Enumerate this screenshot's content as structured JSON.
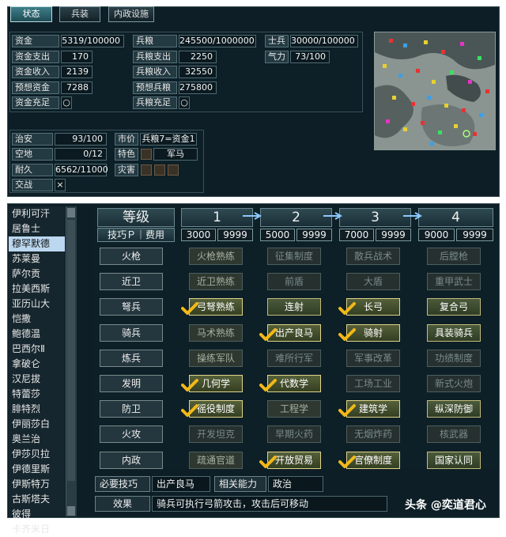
{
  "tabs": [
    "状态",
    "兵装",
    "内政设施"
  ],
  "stats": {
    "funds": {
      "label": "资金",
      "value": "5319/100000"
    },
    "funds_out": {
      "label": "资金支出",
      "value": "170"
    },
    "funds_in": {
      "label": "资金收入",
      "value": "2139"
    },
    "funds_est": {
      "label": "预想资金",
      "value": "7288"
    },
    "funds_ok": {
      "label": "资金充足",
      "value": "○"
    },
    "food": {
      "label": "兵粮",
      "value": "245500/1000000"
    },
    "food_out": {
      "label": "兵粮支出",
      "value": "2250"
    },
    "food_in": {
      "label": "兵粮收入",
      "value": "32550"
    },
    "food_est": {
      "label": "预想兵粮",
      "value": "275800"
    },
    "food_ok": {
      "label": "兵粮充足",
      "value": "○"
    },
    "soldiers": {
      "label": "士兵",
      "value": "30000/100000"
    },
    "morale": {
      "label": "气力",
      "value": "73/100"
    },
    "order": {
      "label": "治安",
      "value": "93/100"
    },
    "land": {
      "label": "空地",
      "value": "0/12"
    },
    "durability": {
      "label": "耐久",
      "value": "6562/11000"
    },
    "battle": {
      "label": "交战",
      "value": "×"
    },
    "price": {
      "label": "市价",
      "value": "兵粮7=资金1"
    },
    "feature": {
      "label": "特色",
      "value": "军马"
    },
    "disaster": {
      "label": "灾害"
    }
  },
  "rulers": [
    "伊利可汗",
    "居鲁士",
    "穆罕默德",
    "苏莱曼",
    "萨尔贡",
    "拉美西斯",
    "亚历山大",
    "恺撒",
    "鲍德温",
    "巴西尔Ⅱ",
    "拿破仑",
    "汉尼拔",
    "特蕾莎",
    "腓特烈",
    "伊丽莎白",
    "奥兰治",
    "伊莎贝拉",
    "伊德里斯",
    "伊斯特万",
    "古斯塔夫",
    "彼得",
    "卡齐米日"
  ],
  "selected_ruler": 2,
  "header": {
    "level_label": "等级",
    "tech_label": "技巧Ｐ｜费用",
    "levels": [
      "1",
      "2",
      "3",
      "4"
    ],
    "points": [
      "3000",
      "5000",
      "7000",
      "9000"
    ],
    "costs": [
      "9999",
      "9999",
      "9999",
      "9999"
    ]
  },
  "rows": [
    {
      "unit": "火枪",
      "skills": [
        "火枪熟练",
        "征集制度",
        "散兵战术",
        "后膛枪"
      ]
    },
    {
      "unit": "近卫",
      "skills": [
        "近卫熟练",
        "前盾",
        "大盾",
        "重甲武士"
      ]
    },
    {
      "unit": "弩兵",
      "skills": [
        "弓弩熟练",
        "连射",
        "长弓",
        "复合弓"
      ]
    },
    {
      "unit": "骑兵",
      "skills": [
        "马术熟练",
        "出产良马",
        "骑射",
        "具装骑兵"
      ]
    },
    {
      "unit": "炼兵",
      "skills": [
        "操练军队",
        "难所行军",
        "军事改革",
        "功绩制度"
      ]
    },
    {
      "unit": "发明",
      "skills": [
        "几何学",
        "代数学",
        "工场工业",
        "新式火炮"
      ]
    },
    {
      "unit": "防卫",
      "skills": [
        "徭役制度",
        "工程学",
        "建筑学",
        "纵深防御"
      ]
    },
    {
      "unit": "火攻",
      "skills": [
        "开发坦克",
        "早期火药",
        "无烟炸药",
        "核武器"
      ]
    },
    {
      "unit": "内政",
      "skills": [
        "疏通官道",
        "开放贸易",
        "官僚制度",
        "国家认同"
      ]
    }
  ],
  "bottom": {
    "req_label": "必要技巧",
    "req_value": "出产良马",
    "ability_label": "相关能力",
    "ability_value": "政治",
    "effect_label": "效果",
    "effect_value": "骑兵可执行弓箭攻击，攻击后可移动"
  },
  "watermark": "头条 @奕道君心"
}
